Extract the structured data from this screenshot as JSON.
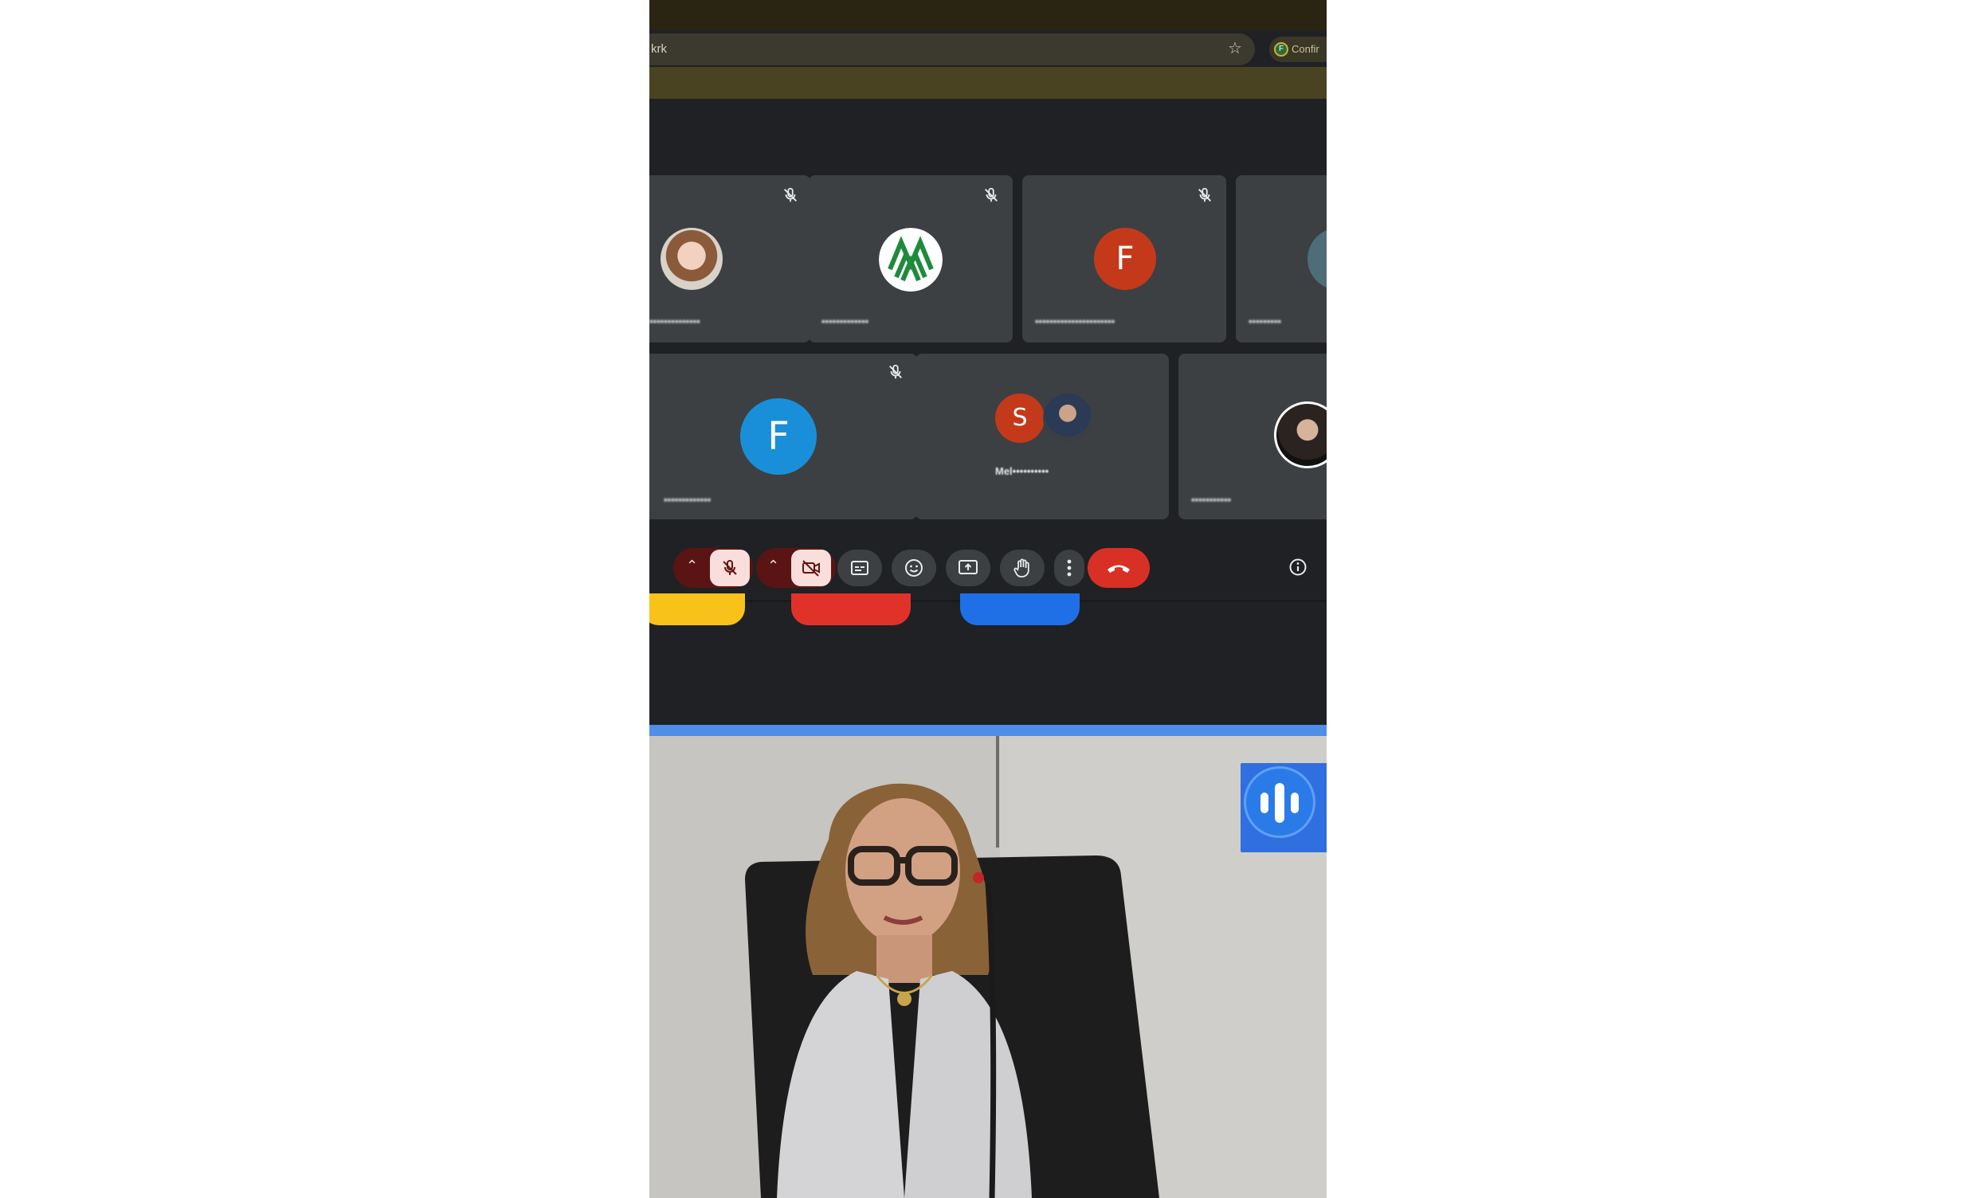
{
  "browser": {
    "url_fragment": "krk",
    "profile_label": "Confir"
  },
  "tiles_row1": [
    {
      "name": "••••••••••••••",
      "avatar_type": "photo",
      "muted": true
    },
    {
      "name": "•••••••••••••",
      "avatar_type": "logo",
      "muted": true
    },
    {
      "name": "••••••••••••••••••••••",
      "avatar_letter": "F",
      "avatar_color": "#c5391b",
      "muted": true
    },
    {
      "name": "•••••••••",
      "avatar_type": "partial",
      "muted": false
    }
  ],
  "tiles_row2": [
    {
      "name": "•••••••••••••",
      "avatar_letter": "F",
      "avatar_color": "#1a8fd9",
      "muted": true
    },
    {
      "name": "Mel••••••••••",
      "avatar_letter": "S",
      "avatar_color": "#c5391b",
      "muted": false
    },
    {
      "name": "•••••••••••",
      "avatar_type": "photo",
      "muted": false
    }
  ],
  "controls": {
    "accent_danger": "#b3261e",
    "accent_muted": "#f9dedc",
    "icons": [
      "chevron-up-icon",
      "mic-off-icon",
      "chevron-up-icon",
      "camera-off-icon",
      "captions-icon",
      "emoji-icon",
      "present-icon",
      "raise-hand-icon",
      "more-icon",
      "end-call-icon",
      "info-icon"
    ]
  },
  "pills": {
    "colors": [
      "#f9c21a",
      "#e1322a",
      "#1f6fe6"
    ]
  },
  "overlay": {
    "icon": "voice-bars-icon",
    "color": "#2f6fe0"
  }
}
